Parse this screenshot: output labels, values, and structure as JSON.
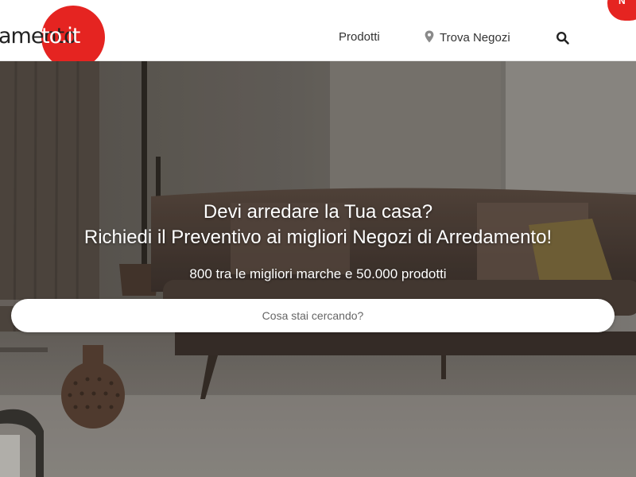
{
  "header": {
    "logo_left": "amento",
    "logo_right": ".it",
    "corner_badge": "N",
    "nav": {
      "products": "Prodotti",
      "find_stores": "Trova Negozi"
    }
  },
  "hero": {
    "headline": "Devi arredare la Tua casa?",
    "subheadline": "Richiedi il Preventivo ai migliori Negozi di Arredamento!",
    "tagline": "800 tra le migliori marche e 50.000 prodotti",
    "search_placeholder": "Cosa stai cercando?"
  },
  "colors": {
    "brand_red": "#e52421",
    "header_bg": "#ffffff",
    "text_dark": "#333333"
  },
  "icons": {
    "location": "map-pin-icon",
    "search": "magnifier-icon"
  }
}
